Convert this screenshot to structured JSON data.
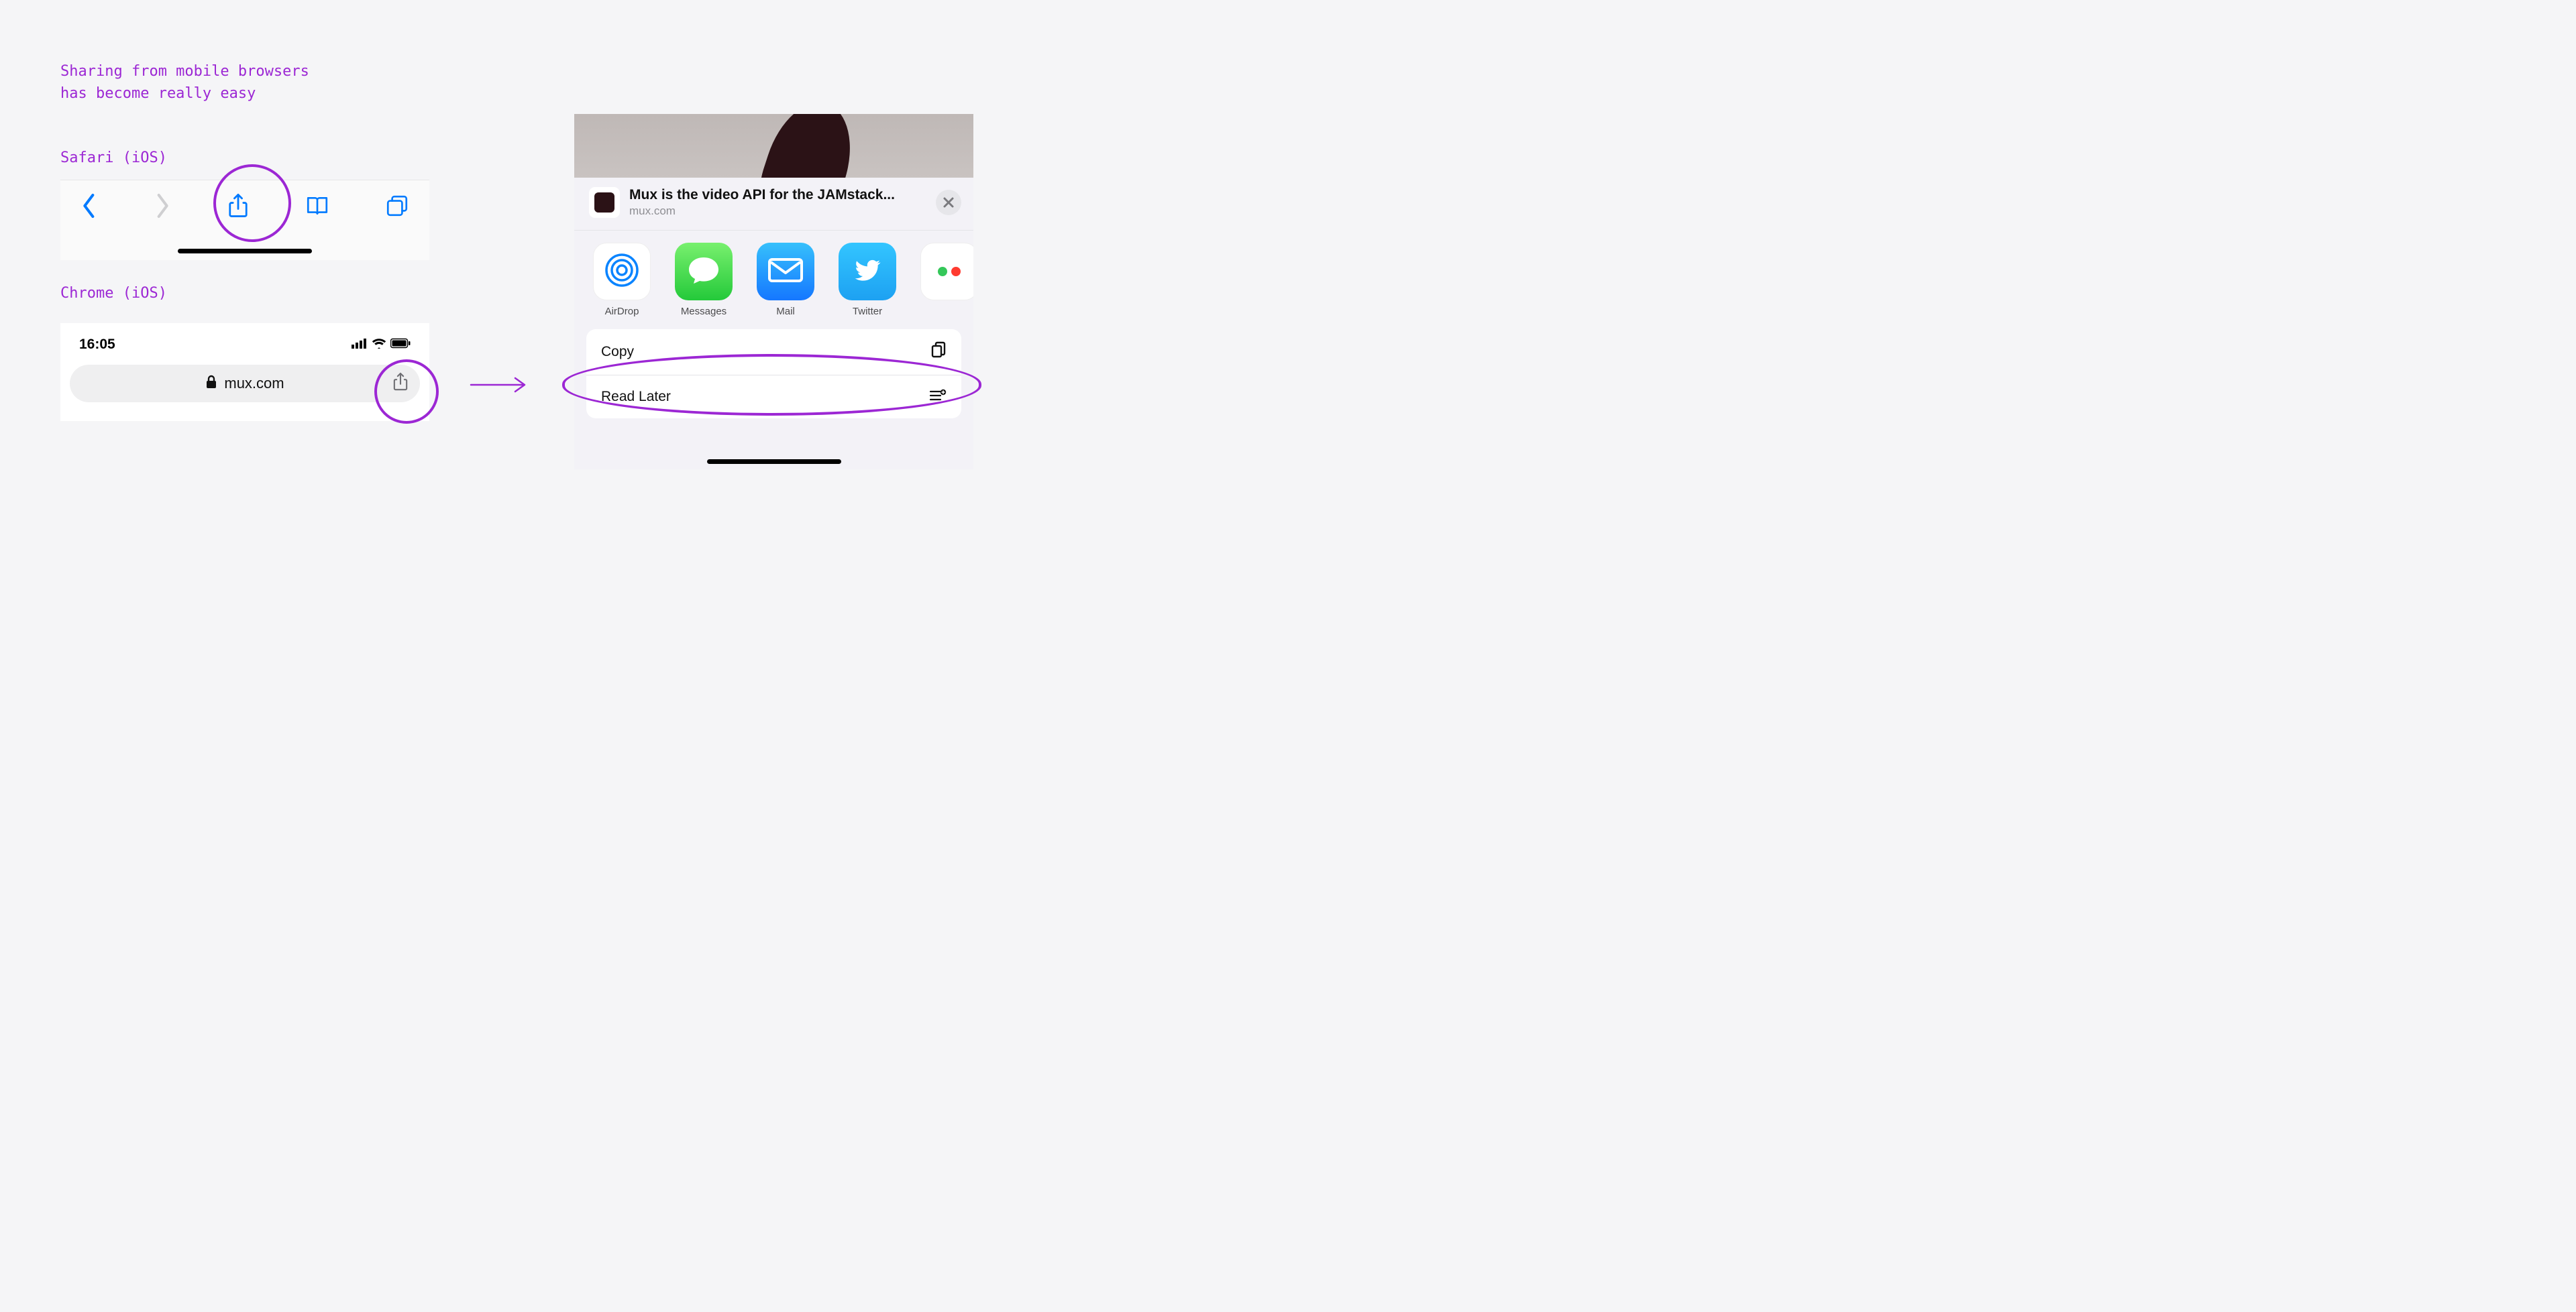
{
  "heading": "Sharing from mobile browsers\nhas become really easy",
  "labels": {
    "safari": "Safari (iOS)",
    "chrome": "Chrome (iOS)"
  },
  "chrome": {
    "time": "16:05",
    "url": "mux.com"
  },
  "sheet": {
    "title": "Mux is the video API for the JAMstack...",
    "subtitle": "mux.com",
    "apps": {
      "airdrop": "AirDrop",
      "messages": "Messages",
      "mail": "Mail",
      "twitter": "Twitter"
    },
    "actions": {
      "copy": "Copy",
      "read_later": "Read Later"
    }
  }
}
